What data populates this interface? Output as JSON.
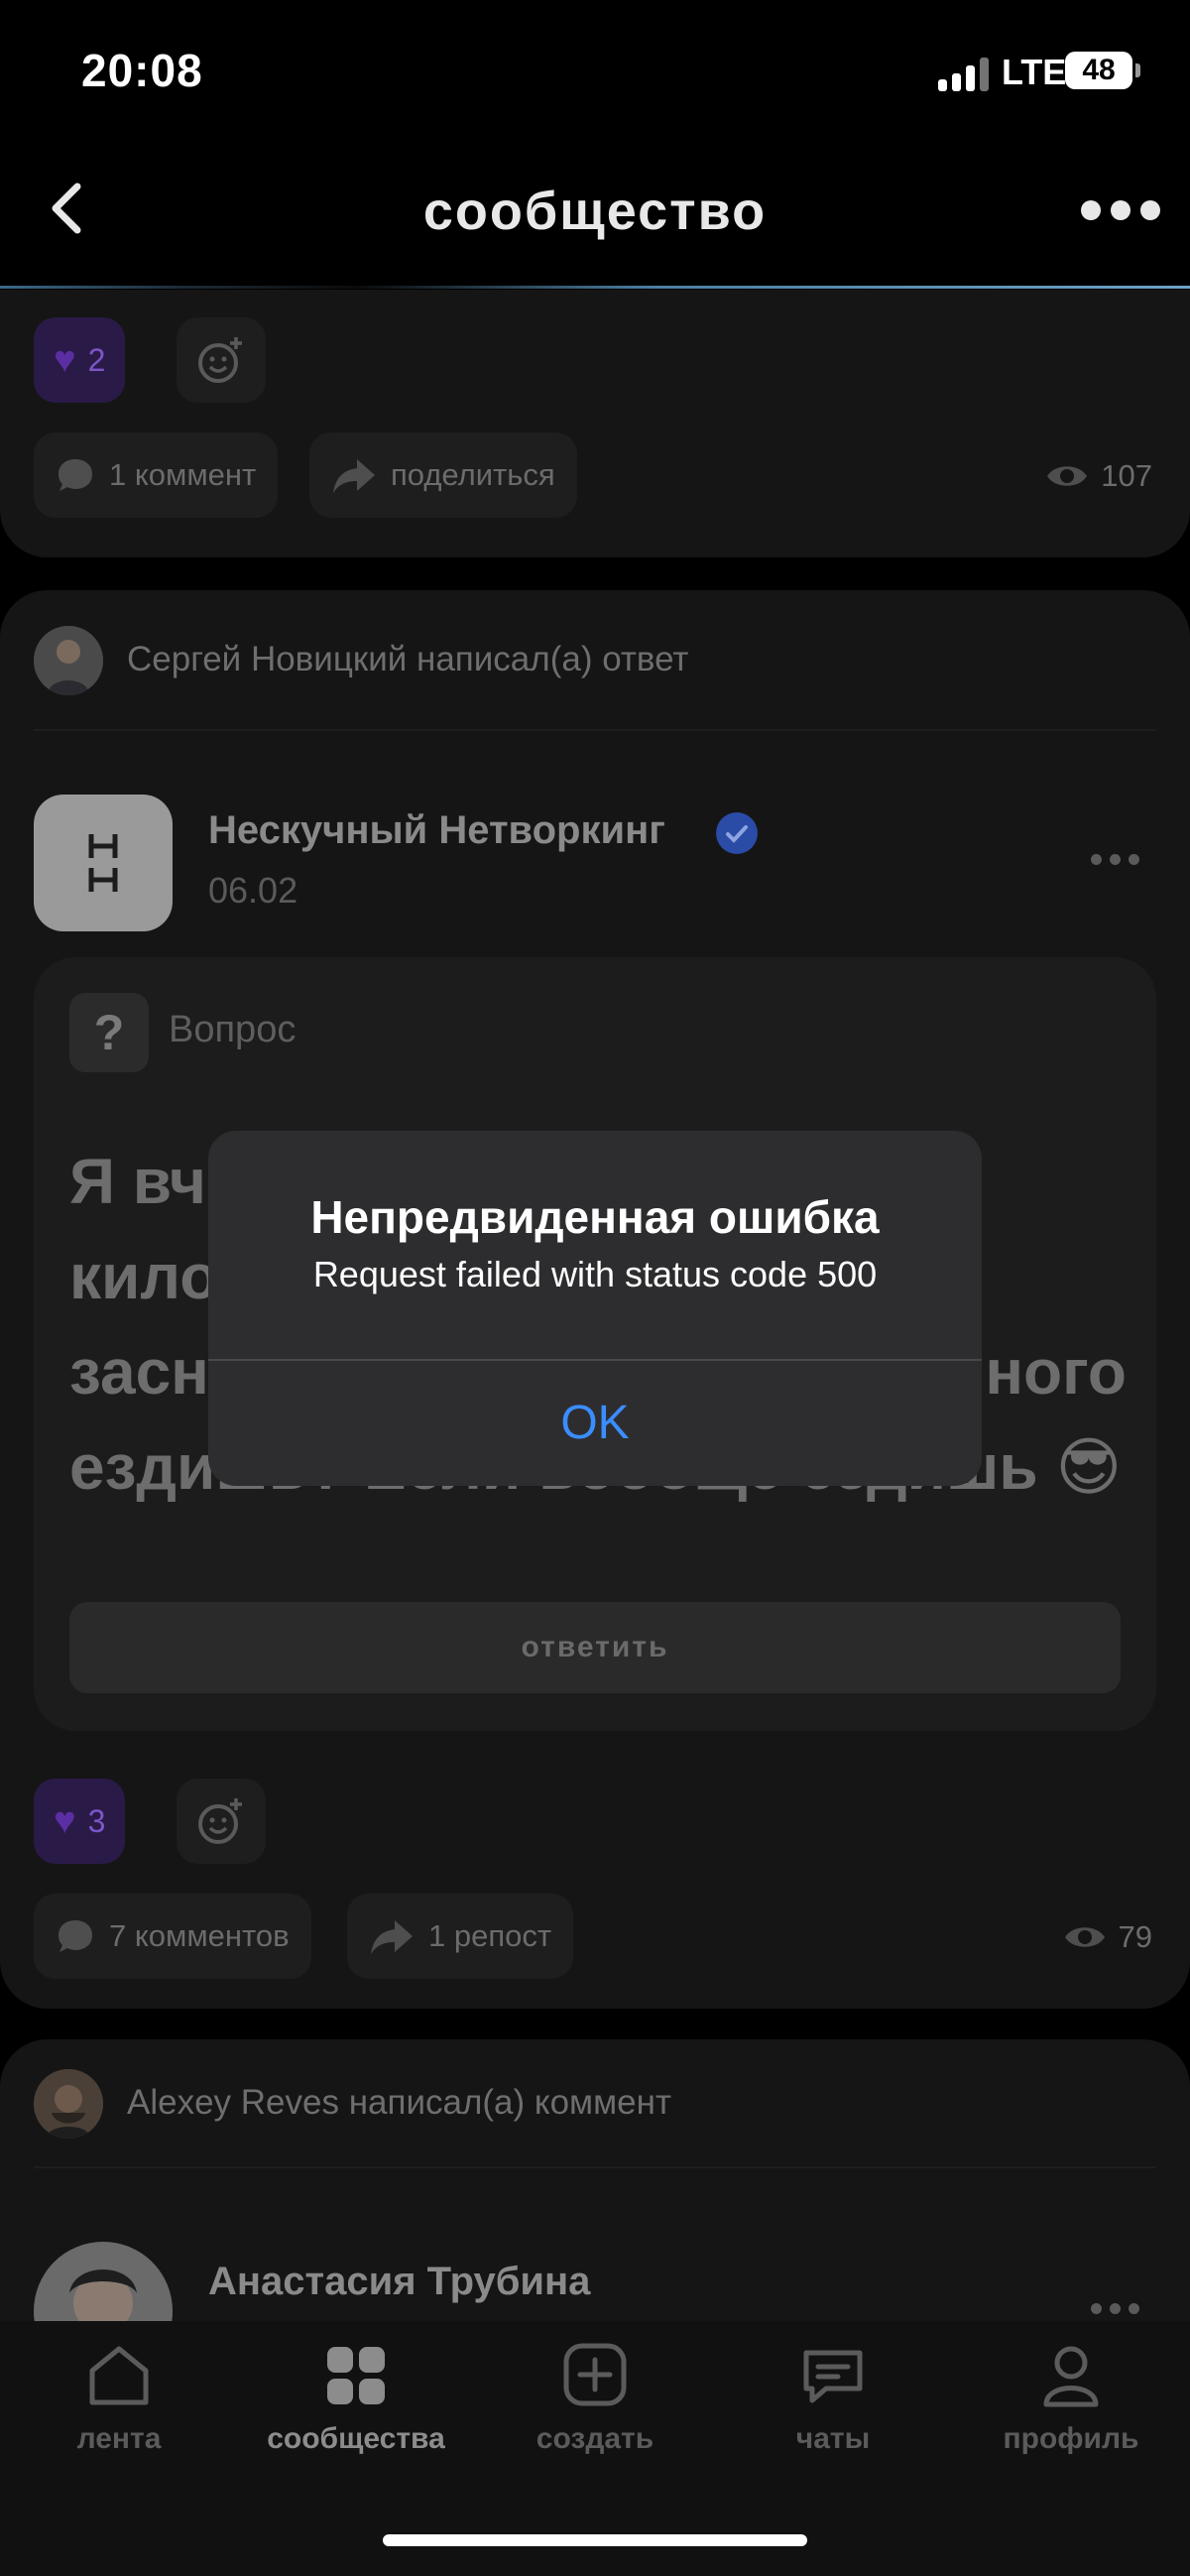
{
  "status_bar": {
    "time": "20:08",
    "network": "LTE",
    "battery": "48"
  },
  "header": {
    "title": "сообщество"
  },
  "post1": {
    "reaction_count": "2",
    "comments_label": "1 коммент",
    "share_label": "поделиться",
    "views": "107"
  },
  "post2": {
    "activity": "Сергей Новицкий написал(а) ответ",
    "group_initials": "Н\nН",
    "author": "Нескучный Нетворкинг",
    "date": "06.02",
    "question_label": "Вопрос",
    "question_lines": [
      "Я вче",
      "кило",
      "засн",
      "ездишь? Если вообще ездишь 😎"
    ],
    "question_tails": [
      "",
      "",
      "ного",
      ""
    ],
    "answer_button": "ответить",
    "reaction_count": "3",
    "comments_label": "7 комментов",
    "repost_label": "1 репост",
    "views": "79"
  },
  "post3": {
    "activity": "Alexey Reves написал(а) коммент",
    "author": "Анастасия Трубина"
  },
  "dialog": {
    "title": "Непредвиденная ошибка",
    "message": "Request failed with status code 500",
    "ok_label": "OK"
  },
  "tabbar": {
    "items": [
      {
        "label": "лента",
        "icon": "home-icon"
      },
      {
        "label": "сообщества",
        "icon": "grid-icon"
      },
      {
        "label": "создать",
        "icon": "plus-square-icon"
      },
      {
        "label": "чаты",
        "icon": "chat-icon"
      },
      {
        "label": "профиль",
        "icon": "person-icon"
      }
    ],
    "active_index": 1
  }
}
